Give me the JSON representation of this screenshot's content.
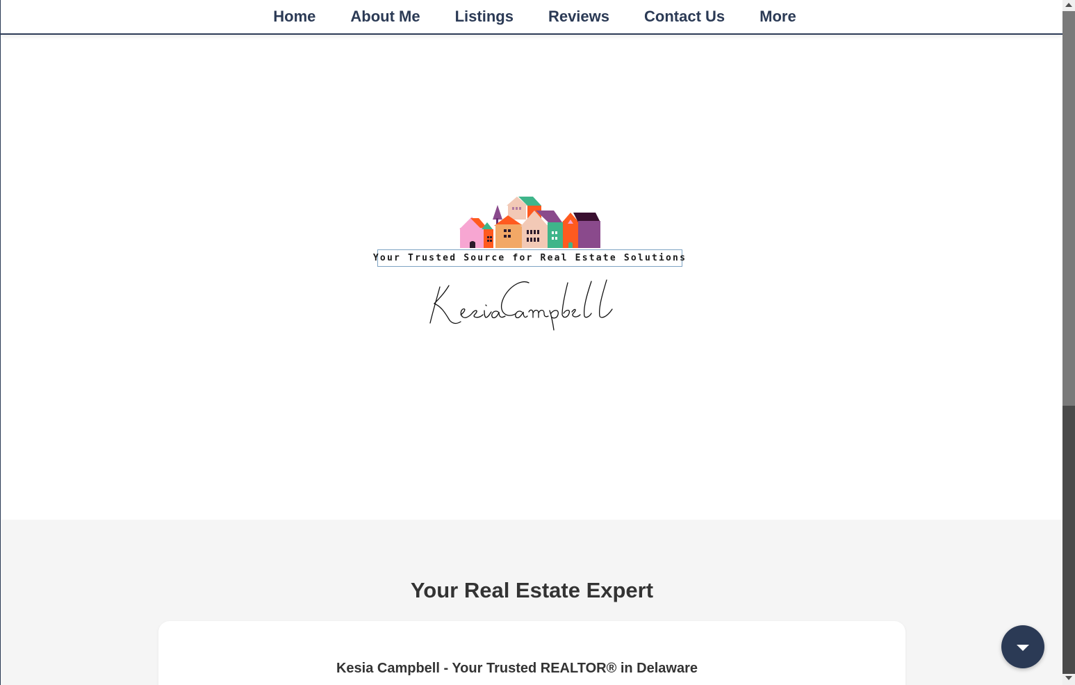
{
  "nav": {
    "items": [
      {
        "label": "Home"
      },
      {
        "label": "About Me"
      },
      {
        "label": "Listings"
      },
      {
        "label": "Reviews"
      },
      {
        "label": "Contact Us"
      },
      {
        "label": "More"
      }
    ]
  },
  "hero": {
    "logo_tagline": "Your Trusted Source for Real Estate Solutions",
    "logo_signature": "Kesia Campbell"
  },
  "section": {
    "title": "Your Real Estate Expert",
    "card_heading": "Kesia Campbell - Your Trusted REALTOR® in Delaware"
  },
  "fab": {
    "icon": "chevron-down-icon"
  },
  "colors": {
    "brand_navy": "#2b3a55",
    "section_bg": "#f5f5f5",
    "text_dark": "#333333"
  }
}
